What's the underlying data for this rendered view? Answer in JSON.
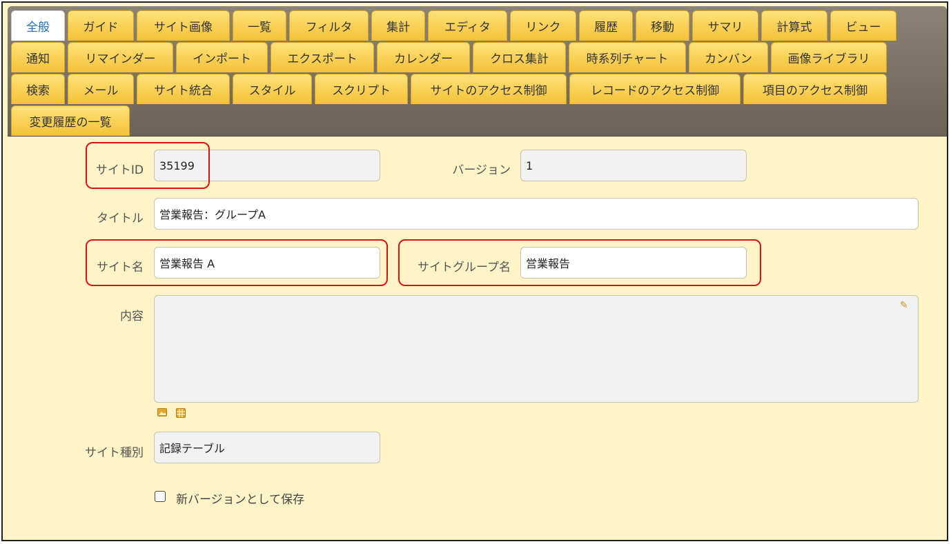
{
  "tabs": {
    "row1": [
      "全般",
      "ガイド",
      "サイト画像",
      "一覧",
      "フィルタ",
      "集計",
      "エディタ",
      "リンク",
      "履歴",
      "移動",
      "サマリ",
      "計算式",
      "ビュー"
    ],
    "row2": [
      "通知",
      "リマインダー",
      "インポート",
      "エクスポート",
      "カレンダー",
      "クロス集計",
      "時系列チャート",
      "カンバン",
      "画像ライブラリ"
    ],
    "row3": [
      "検索",
      "メール",
      "サイト統合",
      "スタイル",
      "スクリプト",
      "サイトのアクセス制御",
      "レコードのアクセス制御",
      "項目のアクセス制御"
    ],
    "row4": [
      "変更履歴の一覧"
    ]
  },
  "form": {
    "site_id": {
      "label": "サイトID",
      "value": "35199"
    },
    "version": {
      "label": "バージョン",
      "value": "1"
    },
    "title": {
      "label": "タイトル",
      "value": "営業報告：グループA"
    },
    "site_name": {
      "label": "サイト名",
      "value": "営業報告 A"
    },
    "site_group": {
      "label": "サイトグループ名",
      "value": "営業報告"
    },
    "content": {
      "label": "内容",
      "value": ""
    },
    "site_type": {
      "label": "サイト種別",
      "value": "記録テーブル"
    },
    "save_new_version": {
      "label": "新バージョンとして保存",
      "checked": false
    }
  },
  "icons": {
    "edit": "pencil-icon",
    "image": "image-icon",
    "attachment": "grid-icon"
  },
  "colors": {
    "tab": "#f3c136",
    "active_tab_text": "#1f6fbf",
    "highlight": "#e01010",
    "page_bg": "#fff3c8"
  }
}
